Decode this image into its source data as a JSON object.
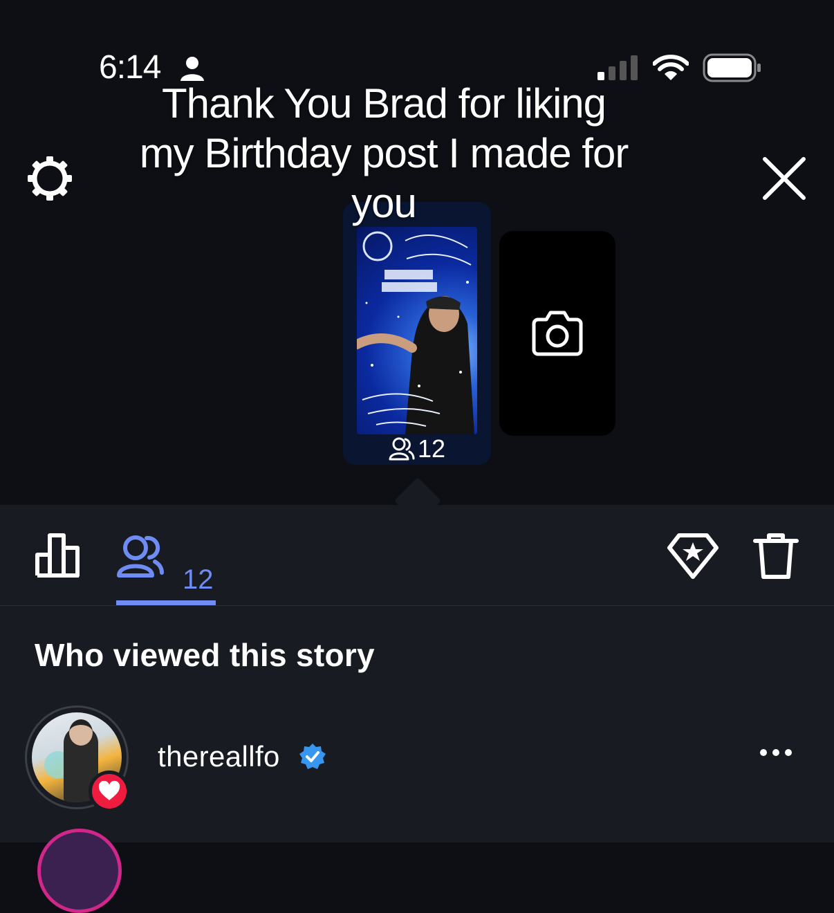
{
  "status_bar": {
    "time": "6:14"
  },
  "story": {
    "caption": "Thank You Brad for liking my Birthday post I made for you",
    "view_count": "12"
  },
  "toolbar": {
    "viewers_count": "12"
  },
  "viewers": {
    "section_title": "Who viewed this story",
    "items": [
      {
        "username": "thereallfo",
        "verified": true,
        "liked": true
      }
    ]
  },
  "colors": {
    "background": "#0d0f14",
    "sheet": "#181c22",
    "accent": "#6f8cf5",
    "like": "#ee1d40",
    "verified": "#3797f0"
  }
}
